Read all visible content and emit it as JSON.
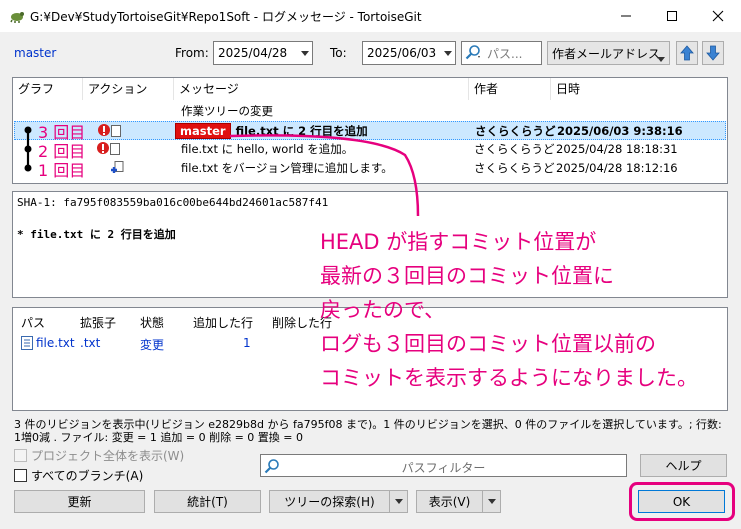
{
  "window": {
    "title": "G:¥Dev¥StudyTortoiseGit¥Repo1Soft - ログメッセージ - TortoiseGit"
  },
  "toolbar": {
    "branch": "master",
    "from_label": "From:",
    "from_date": "2025/04/28",
    "to_label": "To:",
    "to_date": "2025/06/03",
    "search_placeholder": "パス...",
    "filter_combo": "作者メールアドレス"
  },
  "log": {
    "columns": [
      "グラフ",
      "アクション",
      "メッセージ",
      "作者",
      "日時"
    ],
    "rows": [
      {
        "message": "作業ツリーの変更",
        "tag": "",
        "author": "",
        "date": ""
      },
      {
        "message": "file.txt に 2 行目を追加",
        "tag": "master",
        "author": "さくらくらうど",
        "date": "2025/06/03 9:38:16"
      },
      {
        "message": "file.txt に hello, world を追加。",
        "tag": "",
        "author": "さくらくらうど",
        "date": "2025/04/28 18:18:31"
      },
      {
        "message": "file.txt をバージョン管理に追加します。",
        "tag": "",
        "author": "さくらくらうど",
        "date": "2025/04/28 18:12:16"
      }
    ]
  },
  "message_panel": {
    "sha": "SHA-1: fa795f083559ba016c00be644bd24601ac587f41",
    "subject": "* file.txt に 2 行目を追加"
  },
  "files": {
    "columns": [
      "パス",
      "拡張子",
      "状態",
      "追加した行",
      "削除した行"
    ],
    "rows": [
      {
        "path": "file.txt",
        "ext": ".txt",
        "status": "変更",
        "added": "1",
        "deleted": ""
      }
    ]
  },
  "status_text": "3 件のリビジョンを表示中(リビジョン e2829b8d から fa795f08 まで)。1 件のリビジョンを選択、0 件のファイルを選択しています。; 行数: 1増0減 . ファイル: 変更 = 1 追加 = 0 削除 = 0 置換 = 0",
  "checkboxes": {
    "whole_project": "プロジェクト全体を表示(W)",
    "all_branches": "すべてのブランチ(A)"
  },
  "path_filter_placeholder": "パスフィルター",
  "buttons": {
    "help": "ヘルプ",
    "refresh": "更新",
    "stats": "統計(T)",
    "tree": "ツリーの探索(H)",
    "view": "表示(V)",
    "ok": "OK"
  },
  "annotations": {
    "counts": [
      "3 回目",
      "2 回目",
      "1 回目"
    ],
    "lines": [
      "HEAD が指すコミット位置が",
      "最新の３回目のコミット位置に",
      "戻ったので、",
      "ログも３回目のコミット位置以前の",
      "コミットを表示するようになりました。"
    ],
    "color": "#e6007e"
  }
}
